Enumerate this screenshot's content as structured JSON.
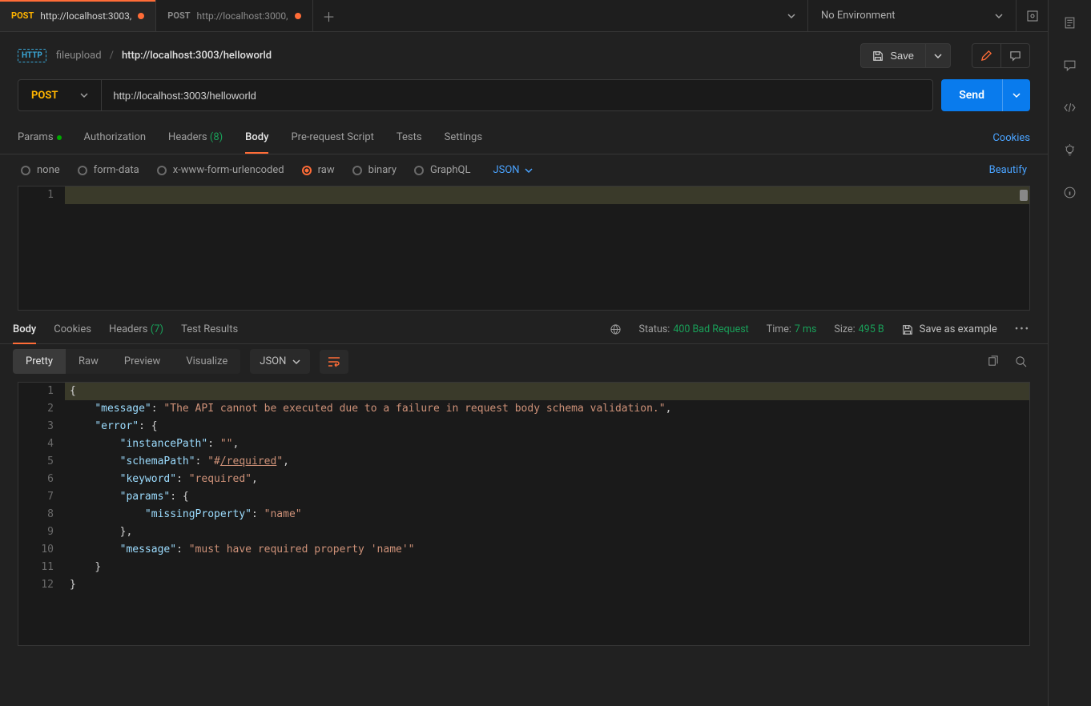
{
  "tabs": [
    {
      "method": "POST",
      "url": "http://localhost:3003,",
      "modified": true,
      "active": true
    },
    {
      "method": "POST",
      "url": "http://localhost:3000,",
      "modified": true,
      "active": false
    }
  ],
  "env_selector": {
    "label": "No Environment"
  },
  "breadcrumb": {
    "folder": "fileupload",
    "name": "http://localhost:3003/helloworld"
  },
  "save_label": "Save",
  "request": {
    "method": "POST",
    "url": "http://localhost:3003/helloworld",
    "send_label": "Send"
  },
  "req_tabs": {
    "params": "Params",
    "authorization": "Authorization",
    "headers": "Headers",
    "headers_count": "(8)",
    "body": "Body",
    "prerequest": "Pre-request Script",
    "tests": "Tests",
    "settings": "Settings",
    "cookies": "Cookies"
  },
  "body_types": {
    "none": "none",
    "formdata": "form-data",
    "urlencoded": "x-www-form-urlencoded",
    "raw": "raw",
    "binary": "binary",
    "graphql": "GraphQL",
    "content_type": "JSON",
    "beautify": "Beautify"
  },
  "req_editor": {
    "lines": [
      ""
    ]
  },
  "resp_tabs": {
    "body": "Body",
    "cookies": "Cookies",
    "headers": "Headers",
    "headers_count": "(7)",
    "tests": "Test Results"
  },
  "resp_meta": {
    "status_label": "Status:",
    "status_value": "400 Bad Request",
    "time_label": "Time:",
    "time_value": "7 ms",
    "size_label": "Size:",
    "size_value": "495 B",
    "save_example": "Save as example"
  },
  "resp_toolbar": {
    "pretty": "Pretty",
    "raw": "Raw",
    "preview": "Preview",
    "visualize": "Visualize",
    "format": "JSON"
  },
  "response_json": {
    "message": "The API cannot be executed due to a failure in request body schema validation.",
    "error": {
      "instancePath": "",
      "schemaPath": "#/required",
      "keyword": "required",
      "params": {
        "missingProperty": "name"
      },
      "message": "must have required property 'name'"
    }
  },
  "resp_lines": [
    [
      {
        "t": "punc",
        "v": "{"
      }
    ],
    [
      {
        "t": "pad",
        "v": "    "
      },
      {
        "t": "key",
        "v": "\"message\""
      },
      {
        "t": "punc",
        "v": ": "
      },
      {
        "t": "str",
        "v": "\"The API cannot be executed due to a failure in request body schema validation.\""
      },
      {
        "t": "punc",
        "v": ","
      }
    ],
    [
      {
        "t": "pad",
        "v": "    "
      },
      {
        "t": "key",
        "v": "\"error\""
      },
      {
        "t": "punc",
        "v": ": {"
      }
    ],
    [
      {
        "t": "pad",
        "v": "        "
      },
      {
        "t": "key",
        "v": "\"instancePath\""
      },
      {
        "t": "punc",
        "v": ": "
      },
      {
        "t": "str",
        "v": "\"\""
      },
      {
        "t": "punc",
        "v": ","
      }
    ],
    [
      {
        "t": "pad",
        "v": "        "
      },
      {
        "t": "key",
        "v": "\"schemaPath\""
      },
      {
        "t": "punc",
        "v": ": "
      },
      {
        "t": "str",
        "v": "\"#"
      },
      {
        "t": "link",
        "v": "/required"
      },
      {
        "t": "str",
        "v": "\""
      },
      {
        "t": "punc",
        "v": ","
      }
    ],
    [
      {
        "t": "pad",
        "v": "        "
      },
      {
        "t": "key",
        "v": "\"keyword\""
      },
      {
        "t": "punc",
        "v": ": "
      },
      {
        "t": "str",
        "v": "\"required\""
      },
      {
        "t": "punc",
        "v": ","
      }
    ],
    [
      {
        "t": "pad",
        "v": "        "
      },
      {
        "t": "key",
        "v": "\"params\""
      },
      {
        "t": "punc",
        "v": ": {"
      }
    ],
    [
      {
        "t": "pad",
        "v": "            "
      },
      {
        "t": "key",
        "v": "\"missingProperty\""
      },
      {
        "t": "punc",
        "v": ": "
      },
      {
        "t": "str",
        "v": "\"name\""
      }
    ],
    [
      {
        "t": "pad",
        "v": "        "
      },
      {
        "t": "punc",
        "v": "},"
      }
    ],
    [
      {
        "t": "pad",
        "v": "        "
      },
      {
        "t": "key",
        "v": "\"message\""
      },
      {
        "t": "punc",
        "v": ": "
      },
      {
        "t": "str",
        "v": "\"must have required property 'name'\""
      }
    ],
    [
      {
        "t": "pad",
        "v": "    "
      },
      {
        "t": "punc",
        "v": "}"
      }
    ],
    [
      {
        "t": "punc",
        "v": "}"
      }
    ]
  ]
}
